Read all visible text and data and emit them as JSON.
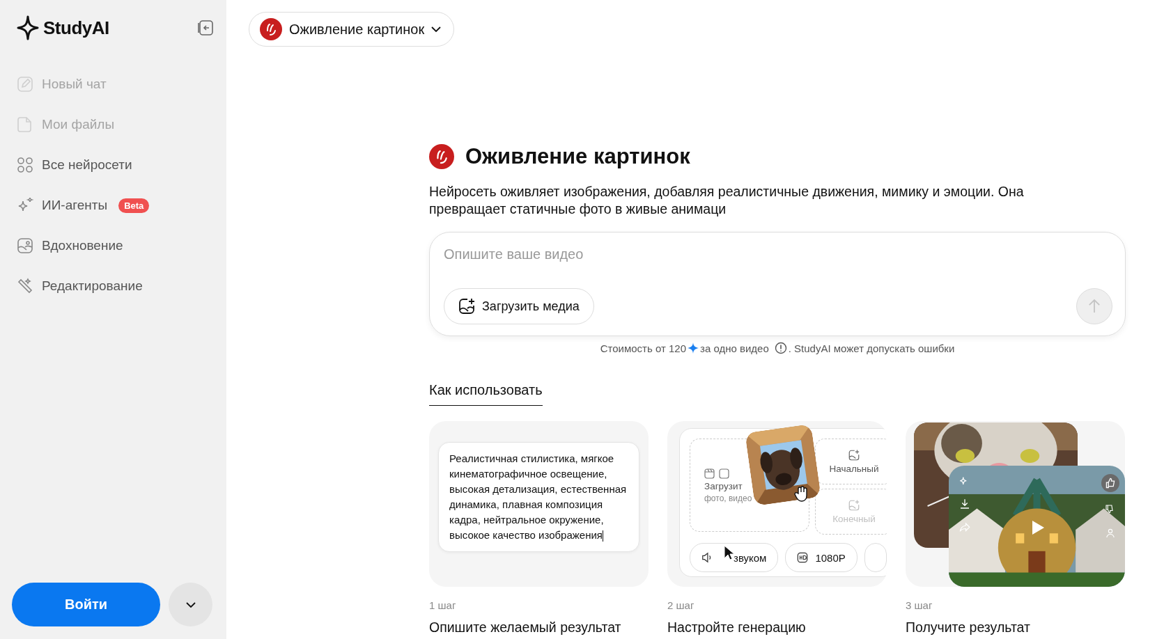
{
  "sidebar": {
    "logo": "StudyAI",
    "items": [
      {
        "kind": "new-chat",
        "label": "Новый чат",
        "disabled": true
      },
      {
        "kind": "files",
        "label": "Мои файлы",
        "disabled": true
      },
      {
        "kind": "all",
        "label": "Все нейросети",
        "disabled": false
      },
      {
        "kind": "agents",
        "label": "ИИ-агенты",
        "disabled": false,
        "badge": "Beta"
      },
      {
        "kind": "inspiration",
        "label": "Вдохновение",
        "disabled": false
      },
      {
        "kind": "edit",
        "label": "Редактирование",
        "disabled": false
      }
    ],
    "login_button": "Войти"
  },
  "model_selector": {
    "label": "Оживление картинок"
  },
  "hero": {
    "title": "Оживление картинок",
    "description": "Нейросеть оживляет изображения, добавляя реалистичные движения, мимику и эмоции. Она превращает статичные фото в живые анимаци"
  },
  "prompt": {
    "placeholder": "Опишите ваше видео",
    "upload_button": "Загрузить медиа"
  },
  "cost_note": {
    "before": "Стоимость от 120",
    "after_star": "за одно видео",
    "after_info": ". StudyAI может допускать ошибки"
  },
  "tabs": [
    {
      "label": "Как использовать",
      "selected": true
    }
  ],
  "steps": [
    {
      "kind": "prompt",
      "step": "1 шаг",
      "title": "Опишите желаемый результат",
      "sample_text": "Реалистичная стилистика, мягкое кинематографичное освещение, высокая детализация, естественная динамика, плавная композиция кадра, нейтральное окружение, высокое качество изображения"
    },
    {
      "kind": "settings",
      "step": "2 шаг",
      "title": "Настройте генерацию",
      "upload_label": "Загрузит",
      "upload_hint": "фото, видео",
      "start_frame": "Начальный",
      "end_frame": "Конечный",
      "chips": [
        "звуком",
        "1080P"
      ]
    },
    {
      "kind": "result",
      "step": "3 шаг",
      "title": "Получите результат"
    }
  ]
}
